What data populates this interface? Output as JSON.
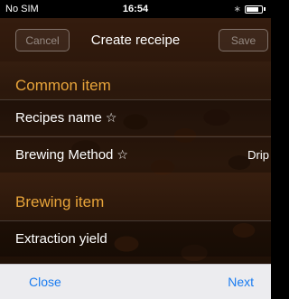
{
  "status_bar": {
    "carrier": "No SIM",
    "time": "16:54",
    "icons": [
      "bluetooth-icon",
      "battery-icon"
    ]
  },
  "nav": {
    "title": "Create receipe",
    "cancel_label": "Cancel",
    "save_label": "Save"
  },
  "sections": [
    {
      "title": "Common item",
      "rows": [
        {
          "label": "Recipes name",
          "star": "☆",
          "value": ""
        },
        {
          "label": "Brewing Method",
          "star": "☆",
          "value": "Drip"
        }
      ]
    },
    {
      "title": "Brewing item",
      "rows": [
        {
          "label": "Extraction yield",
          "star": "",
          "value": ""
        }
      ]
    }
  ],
  "toolbar": {
    "close_label": "Close",
    "next_label": "Next"
  },
  "colors": {
    "section_header": "#e8a43a",
    "toolbar_button": "#1a7cf0"
  }
}
